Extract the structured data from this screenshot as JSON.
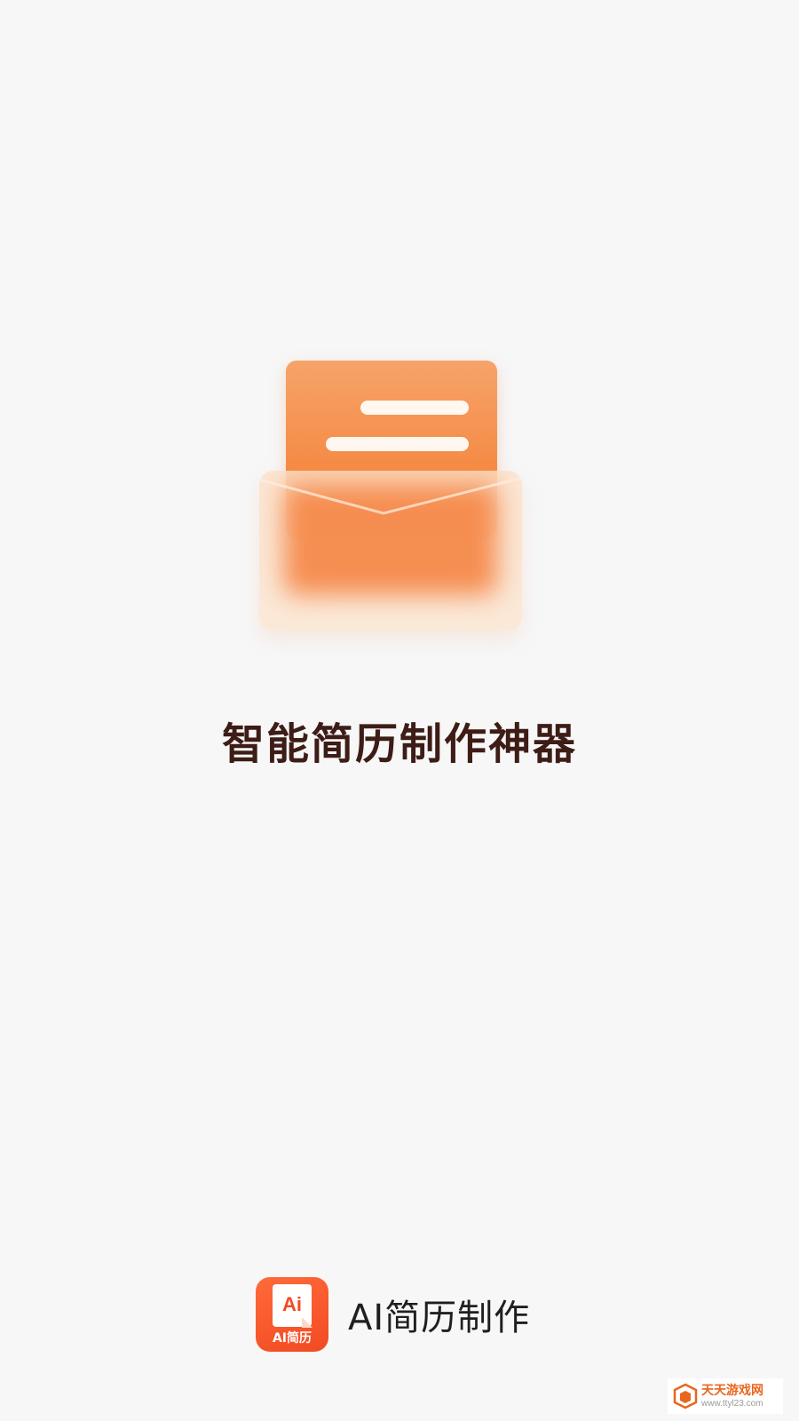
{
  "splash": {
    "slogan": "智能简历制作神器"
  },
  "brand": {
    "icon_text": "Ai",
    "icon_caption": "AI简历",
    "app_name": "AI简历制作"
  },
  "watermark": {
    "title": "天天游戏网",
    "url": "www.ttyl23.com"
  },
  "colors": {
    "background": "#f7f7f8",
    "accent_orange": "#f58b45",
    "brand_red": "#f24a22",
    "slogan_text": "#3d1d16"
  },
  "icons": {
    "illustration": "envelope-document-icon",
    "app_logo": "ai-resume-app-icon",
    "watermark_logo": "watermark-logo-icon"
  }
}
